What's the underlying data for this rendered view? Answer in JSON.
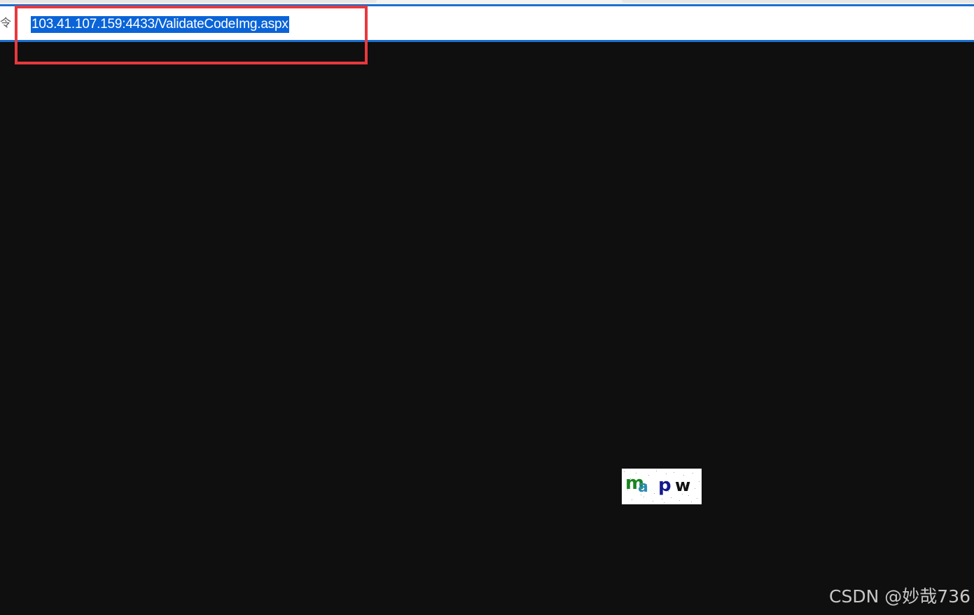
{
  "address_bar": {
    "url": "103.41.107.159:4433/ValidateCodeImg.aspx",
    "lock_fragment": "令"
  },
  "captcha": {
    "characters": [
      "m",
      "a",
      "p",
      "w"
    ],
    "colors": [
      "#18861f",
      "#2a8db0",
      "#131a8a",
      "#101010"
    ]
  },
  "watermark": {
    "text": "CSDN @妙哉736"
  },
  "colors": {
    "accent": "#1a6fd0",
    "selection": "#0a64d8",
    "annotation": "#e8383d",
    "background": "#0f0f0f"
  }
}
